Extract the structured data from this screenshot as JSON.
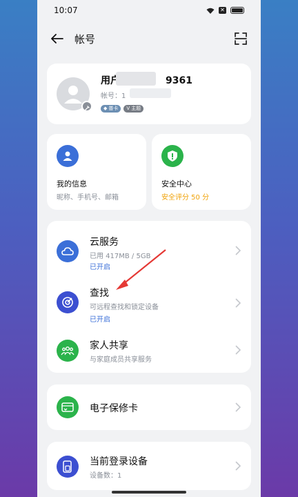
{
  "status_bar": {
    "time": "10:07"
  },
  "header": {
    "title": "帐号"
  },
  "profile": {
    "name_prefix": "用户",
    "name_suffix": "9361",
    "account_label": "帐号：1",
    "badge_1": "普卡",
    "badge_2": "主题"
  },
  "tiles": [
    {
      "title": "我的信息",
      "subtitle": "昵称、手机号、邮箱"
    },
    {
      "title": "安全中心",
      "subtitle": "安全评分 50 分"
    }
  ],
  "services": [
    {
      "title": "云服务",
      "subtitle": "已用 417MB / 5GB",
      "status": "已开启"
    },
    {
      "title": "查找",
      "subtitle": "可远程查找和锁定设备",
      "status": "已开启"
    },
    {
      "title": "家人共享",
      "subtitle": "与家庭成员共享服务"
    }
  ],
  "warranty": {
    "title": "电子保修卡"
  },
  "devices": {
    "title": "当前登录设备",
    "subtitle": "设备数：1"
  },
  "colors": {
    "blue": "#3b6fd8",
    "green": "#2bb34b",
    "indigo": "#3c4fd1",
    "arrow": "#e53935",
    "score": "#f0a30a"
  }
}
